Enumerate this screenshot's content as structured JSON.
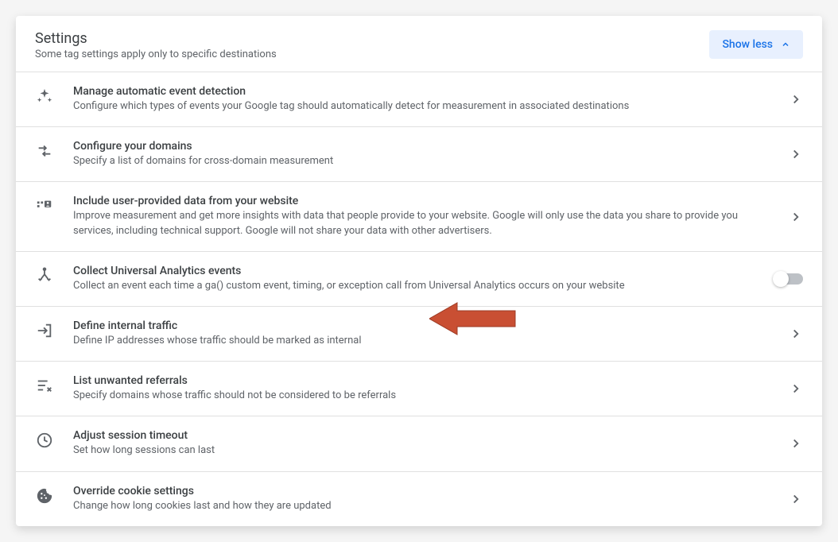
{
  "header": {
    "title": "Settings",
    "subtitle": "Some tag settings apply only to specific destinations",
    "toggle_label": "Show less"
  },
  "rows": [
    {
      "title": "Manage automatic event detection",
      "desc": "Configure which types of events your Google tag should automatically detect for measurement in associated destinations"
    },
    {
      "title": "Configure your domains",
      "desc": "Specify a list of domains for cross-domain measurement"
    },
    {
      "title": "Include user-provided data from your website",
      "desc": "Improve measurement and get more insights with data that people provide to your website. Google will only use the data you share to provide you services, including technical support. Google will not share your data with other advertisers."
    },
    {
      "title": "Collect Universal Analytics events",
      "desc": "Collect an event each time a ga() custom event, timing, or exception call from Universal Analytics occurs on your website"
    },
    {
      "title": "Define internal traffic",
      "desc": "Define IP addresses whose traffic should be marked as internal"
    },
    {
      "title": "List unwanted referrals",
      "desc": "Specify domains whose traffic should not be considered to be referrals"
    },
    {
      "title": "Adjust session timeout",
      "desc": "Set how long sessions can last"
    },
    {
      "title": "Override cookie settings",
      "desc": "Change how long cookies last and how they are updated"
    }
  ]
}
